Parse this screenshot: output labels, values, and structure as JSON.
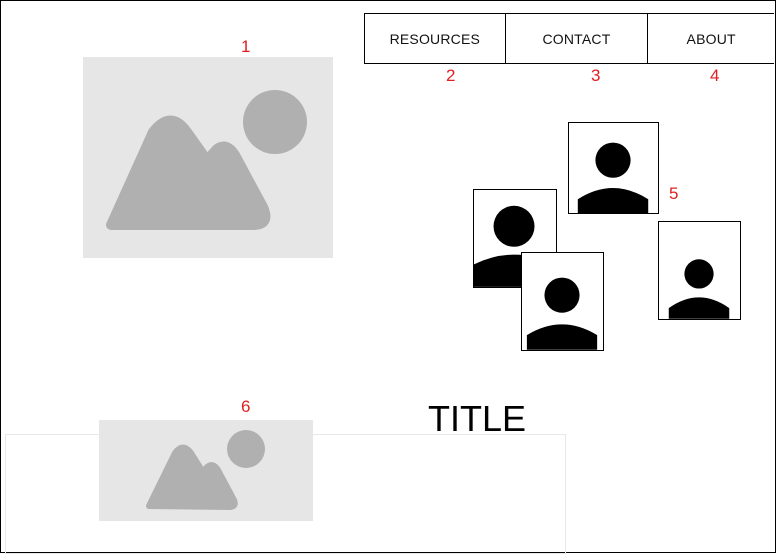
{
  "annotations": {
    "n1": "1",
    "n2": "2",
    "n3": "3",
    "n4": "4",
    "n5": "5",
    "n6": "6"
  },
  "nav": {
    "items": [
      {
        "label": "RESOURCES"
      },
      {
        "label": "CONTACT"
      },
      {
        "label": "ABOUT"
      }
    ]
  },
  "main": {
    "title": "TITLE"
  },
  "icons": {
    "image_placeholder": "image-placeholder-icon",
    "avatar": "person-avatar-icon"
  },
  "colors": {
    "annotation": "#e02020",
    "placeholder_bg": "#e6e6e6",
    "placeholder_fg": "#b0b0b0"
  }
}
